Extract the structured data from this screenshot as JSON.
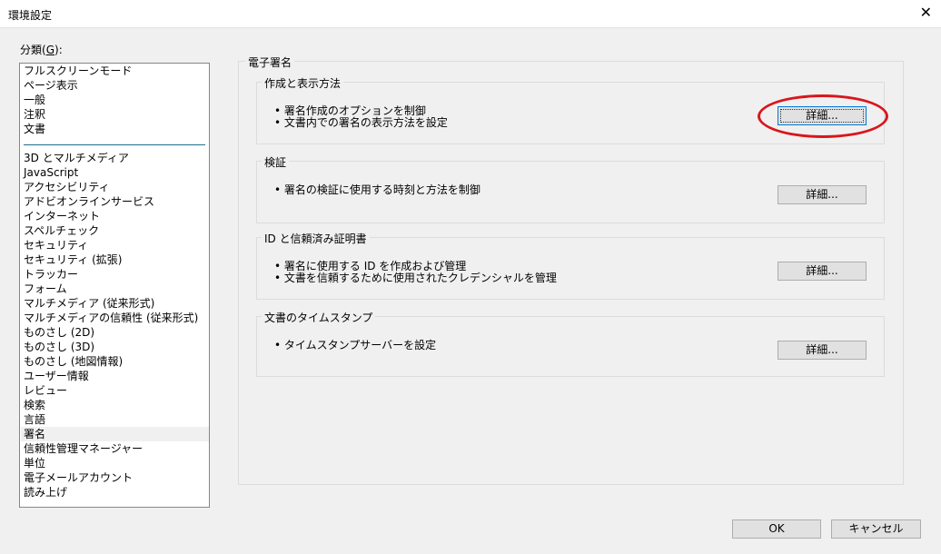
{
  "window": {
    "title": "環境設定",
    "close_glyph": "✕"
  },
  "categories": {
    "label": "分類",
    "mnemonic_open": "(",
    "mnemonic": "G",
    "mnemonic_close": "):",
    "top_items": [
      "フルスクリーンモード",
      "ページ表示",
      "一般",
      "注釈",
      "文書"
    ],
    "items": [
      "3D とマルチメディア",
      "JavaScript",
      "アクセシビリティ",
      "アドビオンラインサービス",
      "インターネット",
      "スペルチェック",
      "セキュリティ",
      "セキュリティ (拡張)",
      "トラッカー",
      "フォーム",
      "マルチメディア (従来形式)",
      "マルチメディアの信頼性 (従来形式)",
      "ものさし (2D)",
      "ものさし (3D)",
      "ものさし (地図情報)",
      "ユーザー情報",
      "レビュー",
      "検索",
      "言語",
      "署名",
      "信頼性管理マネージャー",
      "単位",
      "電子メールアカウント",
      "読み上げ"
    ],
    "selected": "署名"
  },
  "main": {
    "title": "電子署名",
    "groups": [
      {
        "title": "作成と表示方法",
        "lines": [
          "• 署名作成のオプションを制御",
          "• 文書内での署名の表示方法を設定"
        ],
        "button": "詳細..."
      },
      {
        "title": "検証",
        "lines": [
          "• 署名の検証に使用する時刻と方法を制御"
        ],
        "button": "詳細..."
      },
      {
        "title": "ID と信頼済み証明書",
        "lines": [
          "• 署名に使用する ID を作成および管理",
          "• 文書を信頼するために使用されたクレデンシャルを管理"
        ],
        "button": "詳細..."
      },
      {
        "title": "文書のタイムスタンプ",
        "lines": [
          "• タイムスタンプサーバーを設定"
        ],
        "button": "詳細..."
      }
    ]
  },
  "footer": {
    "ok": "OK",
    "cancel": "キャンセル"
  },
  "colors": {
    "annotation": "#d9161c",
    "focus": "#0078d7",
    "background": "#f0f0f0"
  }
}
